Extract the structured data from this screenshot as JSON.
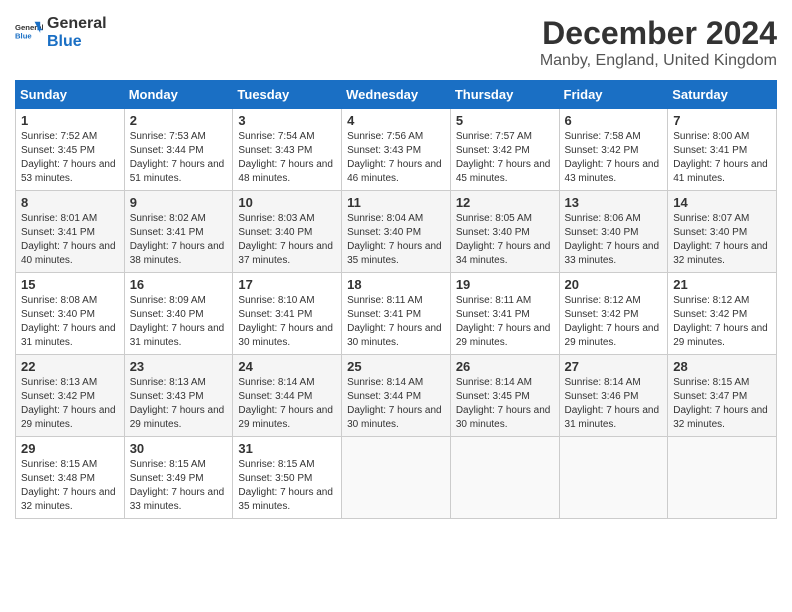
{
  "logo": {
    "general": "General",
    "blue": "Blue"
  },
  "header": {
    "month": "December 2024",
    "location": "Manby, England, United Kingdom"
  },
  "days_of_week": [
    "Sunday",
    "Monday",
    "Tuesday",
    "Wednesday",
    "Thursday",
    "Friday",
    "Saturday"
  ],
  "weeks": [
    [
      {
        "day": "1",
        "sunrise": "7:52 AM",
        "sunset": "3:45 PM",
        "daylight": "7 hours and 53 minutes."
      },
      {
        "day": "2",
        "sunrise": "7:53 AM",
        "sunset": "3:44 PM",
        "daylight": "7 hours and 51 minutes."
      },
      {
        "day": "3",
        "sunrise": "7:54 AM",
        "sunset": "3:43 PM",
        "daylight": "7 hours and 48 minutes."
      },
      {
        "day": "4",
        "sunrise": "7:56 AM",
        "sunset": "3:43 PM",
        "daylight": "7 hours and 46 minutes."
      },
      {
        "day": "5",
        "sunrise": "7:57 AM",
        "sunset": "3:42 PM",
        "daylight": "7 hours and 45 minutes."
      },
      {
        "day": "6",
        "sunrise": "7:58 AM",
        "sunset": "3:42 PM",
        "daylight": "7 hours and 43 minutes."
      },
      {
        "day": "7",
        "sunrise": "8:00 AM",
        "sunset": "3:41 PM",
        "daylight": "7 hours and 41 minutes."
      }
    ],
    [
      {
        "day": "8",
        "sunrise": "8:01 AM",
        "sunset": "3:41 PM",
        "daylight": "7 hours and 40 minutes."
      },
      {
        "day": "9",
        "sunrise": "8:02 AM",
        "sunset": "3:41 PM",
        "daylight": "7 hours and 38 minutes."
      },
      {
        "day": "10",
        "sunrise": "8:03 AM",
        "sunset": "3:40 PM",
        "daylight": "7 hours and 37 minutes."
      },
      {
        "day": "11",
        "sunrise": "8:04 AM",
        "sunset": "3:40 PM",
        "daylight": "7 hours and 35 minutes."
      },
      {
        "day": "12",
        "sunrise": "8:05 AM",
        "sunset": "3:40 PM",
        "daylight": "7 hours and 34 minutes."
      },
      {
        "day": "13",
        "sunrise": "8:06 AM",
        "sunset": "3:40 PM",
        "daylight": "7 hours and 33 minutes."
      },
      {
        "day": "14",
        "sunrise": "8:07 AM",
        "sunset": "3:40 PM",
        "daylight": "7 hours and 32 minutes."
      }
    ],
    [
      {
        "day": "15",
        "sunrise": "8:08 AM",
        "sunset": "3:40 PM",
        "daylight": "7 hours and 31 minutes."
      },
      {
        "day": "16",
        "sunrise": "8:09 AM",
        "sunset": "3:40 PM",
        "daylight": "7 hours and 31 minutes."
      },
      {
        "day": "17",
        "sunrise": "8:10 AM",
        "sunset": "3:41 PM",
        "daylight": "7 hours and 30 minutes."
      },
      {
        "day": "18",
        "sunrise": "8:11 AM",
        "sunset": "3:41 PM",
        "daylight": "7 hours and 30 minutes."
      },
      {
        "day": "19",
        "sunrise": "8:11 AM",
        "sunset": "3:41 PM",
        "daylight": "7 hours and 29 minutes."
      },
      {
        "day": "20",
        "sunrise": "8:12 AM",
        "sunset": "3:42 PM",
        "daylight": "7 hours and 29 minutes."
      },
      {
        "day": "21",
        "sunrise": "8:12 AM",
        "sunset": "3:42 PM",
        "daylight": "7 hours and 29 minutes."
      }
    ],
    [
      {
        "day": "22",
        "sunrise": "8:13 AM",
        "sunset": "3:42 PM",
        "daylight": "7 hours and 29 minutes."
      },
      {
        "day": "23",
        "sunrise": "8:13 AM",
        "sunset": "3:43 PM",
        "daylight": "7 hours and 29 minutes."
      },
      {
        "day": "24",
        "sunrise": "8:14 AM",
        "sunset": "3:44 PM",
        "daylight": "7 hours and 29 minutes."
      },
      {
        "day": "25",
        "sunrise": "8:14 AM",
        "sunset": "3:44 PM",
        "daylight": "7 hours and 30 minutes."
      },
      {
        "day": "26",
        "sunrise": "8:14 AM",
        "sunset": "3:45 PM",
        "daylight": "7 hours and 30 minutes."
      },
      {
        "day": "27",
        "sunrise": "8:14 AM",
        "sunset": "3:46 PM",
        "daylight": "7 hours and 31 minutes."
      },
      {
        "day": "28",
        "sunrise": "8:15 AM",
        "sunset": "3:47 PM",
        "daylight": "7 hours and 32 minutes."
      }
    ],
    [
      {
        "day": "29",
        "sunrise": "8:15 AM",
        "sunset": "3:48 PM",
        "daylight": "7 hours and 32 minutes."
      },
      {
        "day": "30",
        "sunrise": "8:15 AM",
        "sunset": "3:49 PM",
        "daylight": "7 hours and 33 minutes."
      },
      {
        "day": "31",
        "sunrise": "8:15 AM",
        "sunset": "3:50 PM",
        "daylight": "7 hours and 35 minutes."
      },
      null,
      null,
      null,
      null
    ]
  ]
}
